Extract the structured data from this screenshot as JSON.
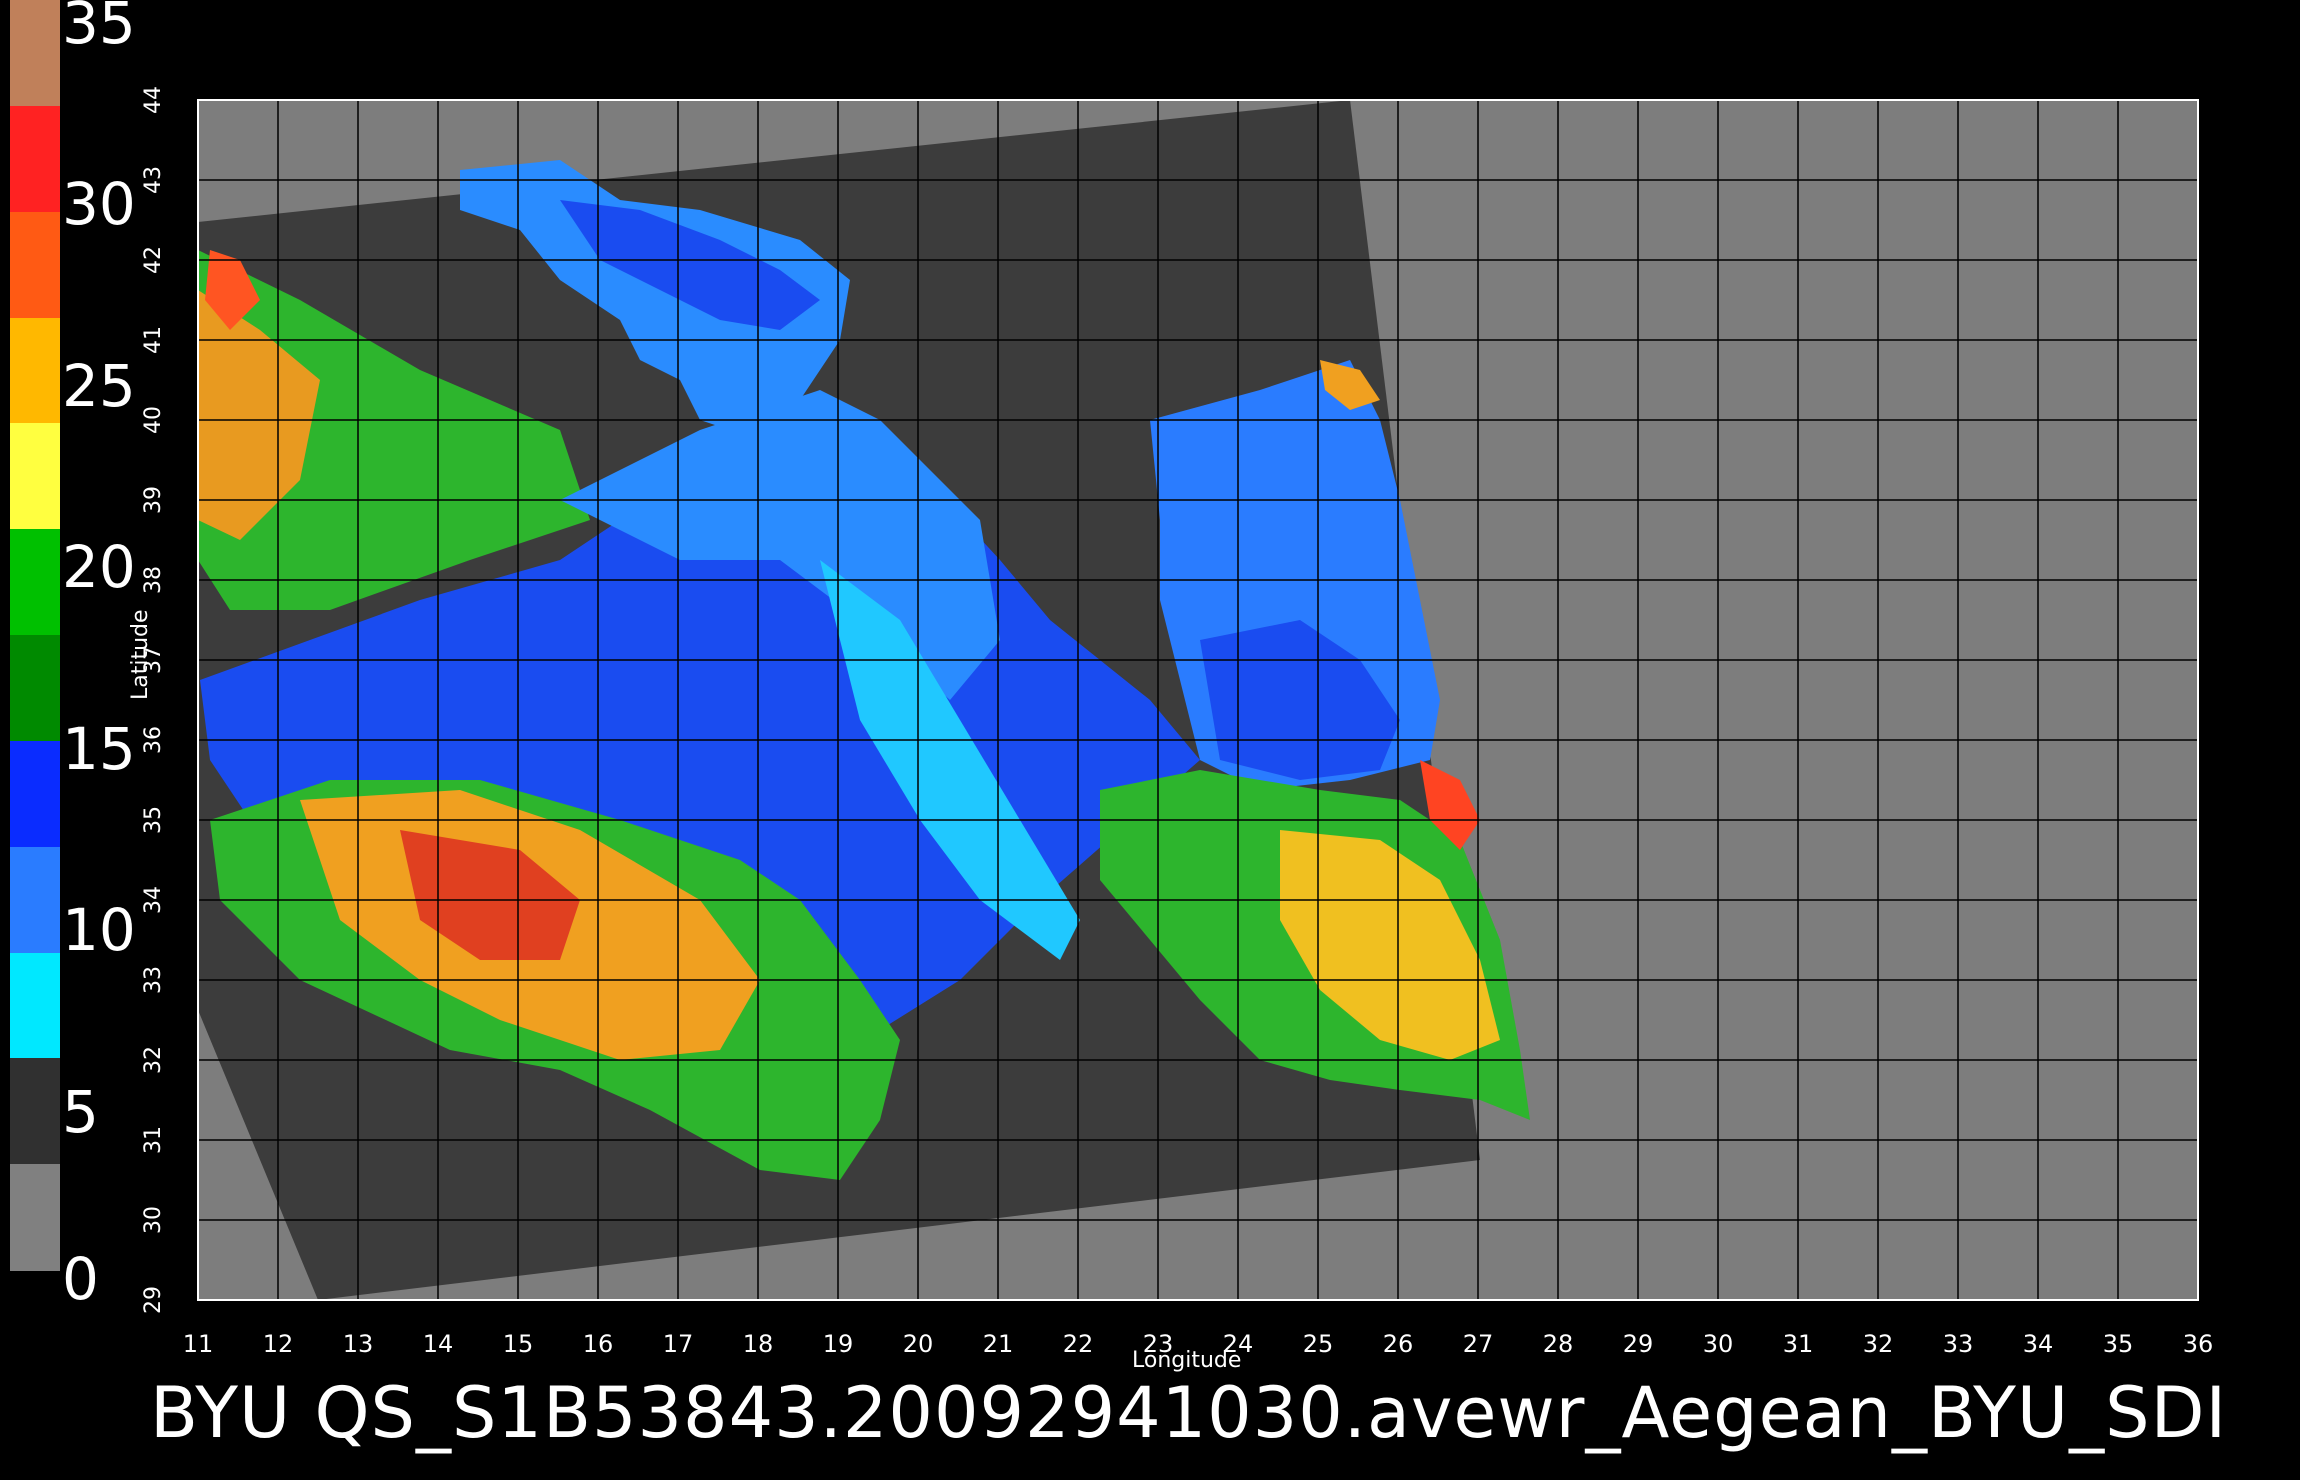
{
  "colorbar": {
    "labels": [
      "35",
      "30",
      "25",
      "20",
      "15",
      "10",
      "5",
      "0"
    ],
    "bands": [
      {
        "color": "#c0805a"
      },
      {
        "color": "#ff2222"
      },
      {
        "color": "#ff5a14"
      },
      {
        "color": "#ffb800"
      },
      {
        "color": "#ffff40"
      },
      {
        "color": "#00c000"
      },
      {
        "color": "#008a00"
      },
      {
        "color": "#0a2cff"
      },
      {
        "color": "#2a7cff"
      },
      {
        "color": "#00e8ff"
      },
      {
        "color": "#303030"
      },
      {
        "color": "#808080"
      }
    ]
  },
  "axes": {
    "xlabel": "Longitude",
    "ylabel": "Latitude",
    "lon_ticks": [
      "11",
      "12",
      "13",
      "14",
      "15",
      "16",
      "17",
      "18",
      "19",
      "20",
      "21",
      "22",
      "23",
      "24",
      "25",
      "26",
      "27",
      "28",
      "29",
      "30",
      "31",
      "32",
      "33",
      "34",
      "35",
      "36"
    ],
    "lat_ticks": [
      "29",
      "30",
      "31",
      "32",
      "33",
      "34",
      "35",
      "36",
      "37",
      "38",
      "39",
      "40",
      "41",
      "42",
      "43",
      "44"
    ]
  },
  "caption": "BYU  QS_S1B53843.20092941030.avewr_Aegean_BYU_SDI"
}
